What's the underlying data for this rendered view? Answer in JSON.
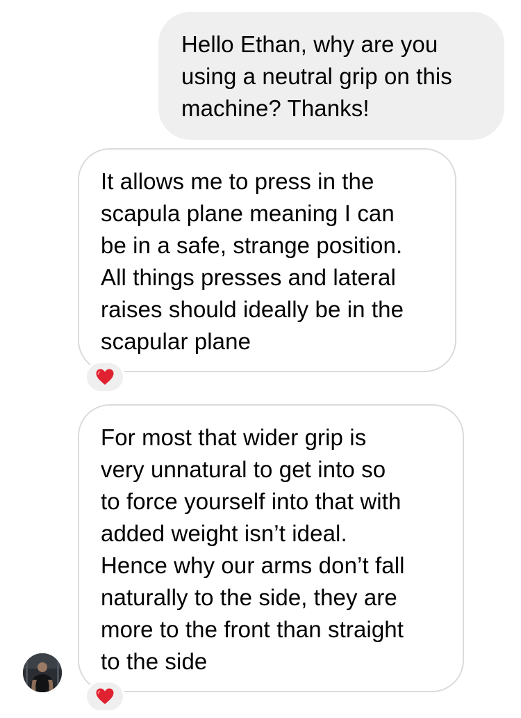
{
  "messages": [
    {
      "sender": "me",
      "text": "Hello Ethan, why are you\nusing a neutral grip on this\nmachine? Thanks!"
    },
    {
      "sender": "other",
      "text": "It allows me to press in the\nscapula plane meaning I can\nbe in a safe, strange position.\nAll things presses and lateral\nraises should ideally be in the\nscapular plane",
      "reaction": "heart"
    },
    {
      "sender": "other",
      "text": "For most that wider grip is\nvery unnatural to get into so\nto force yourself into that with\nadded weight isn’t ideal.\nHence why our arms don’t fall\nnaturally to the side, they are\nmore to the front than straight\nto the side",
      "reaction": "heart"
    }
  ],
  "colors": {
    "sent_bubble": "#efefef",
    "received_border": "#dbdbdb",
    "heart": "#e0212f"
  },
  "icons": {
    "reaction": "red-heart-icon",
    "avatar": "contact-avatar"
  }
}
